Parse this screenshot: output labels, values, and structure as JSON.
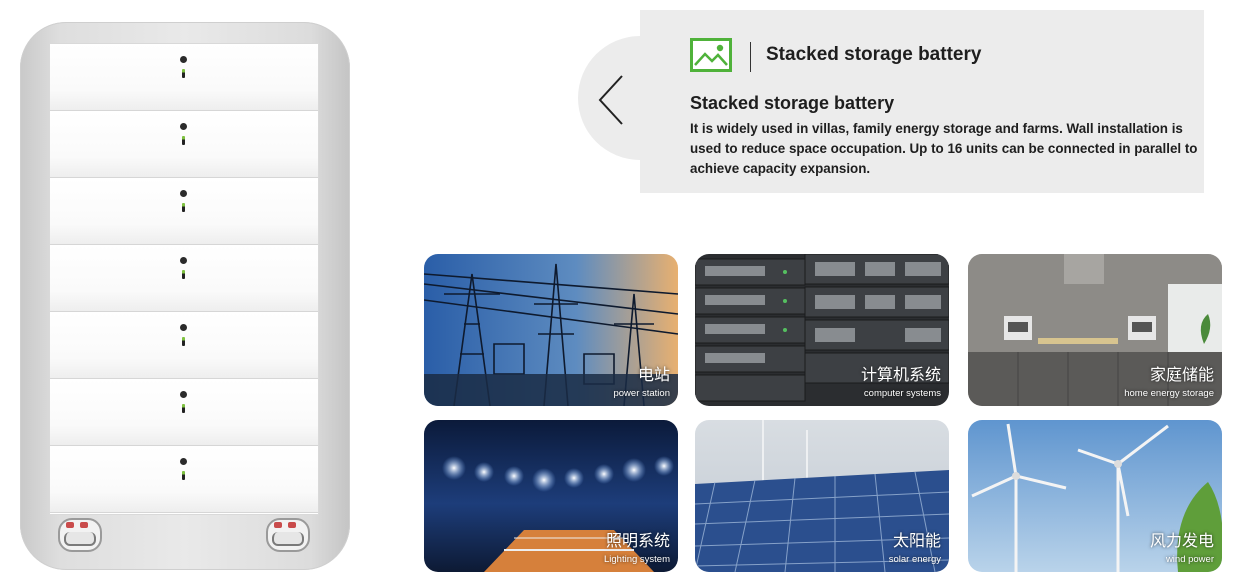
{
  "panel": {
    "title": "Stacked storage battery",
    "product_name": "Stacked storage battery",
    "description": "It is widely used in villas, family energy storage and farms. Wall installation is used to reduce space occupation. Up to 16 units can be connected in parallel to achieve capacity expansion.",
    "icon": "image-icon",
    "nav_icon": "chevron-left-icon"
  },
  "applications": [
    {
      "title": "电站",
      "subtitle": "power station"
    },
    {
      "title": "计算机系统",
      "subtitle": "computer systems"
    },
    {
      "title": "家庭储能",
      "subtitle": "home energy storage"
    },
    {
      "title": "照明系统",
      "subtitle": "Lighting system"
    },
    {
      "title": "太阳能",
      "subtitle": "solar energy"
    },
    {
      "title": "风力发电",
      "subtitle": "wind power"
    }
  ],
  "colors": {
    "accent": "#4fb23a",
    "panel_bg": "#ececec",
    "text": "#1e1e1e"
  },
  "battery": {
    "modules": 7
  }
}
